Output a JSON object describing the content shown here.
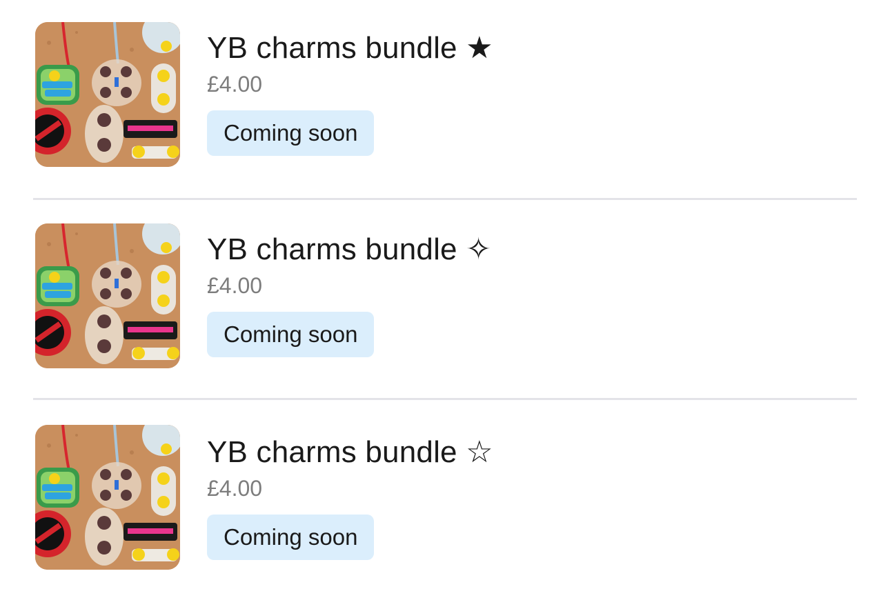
{
  "products": [
    {
      "title": "YB charms bundle ★",
      "price": "£4.00",
      "status": "Coming soon",
      "image_icon": "charms-photo"
    },
    {
      "title": "YB charms bundle ✧",
      "price": "£4.00",
      "status": "Coming soon",
      "image_icon": "charms-photo"
    },
    {
      "title": "YB charms bundle ☆",
      "price": "£4.00",
      "status": "Coming soon",
      "image_icon": "charms-photo"
    }
  ],
  "colors": {
    "badge_bg": "#dbeefc",
    "divider": "#e3e3e8",
    "price": "#7d7d7d",
    "text": "#1a1a1a"
  }
}
